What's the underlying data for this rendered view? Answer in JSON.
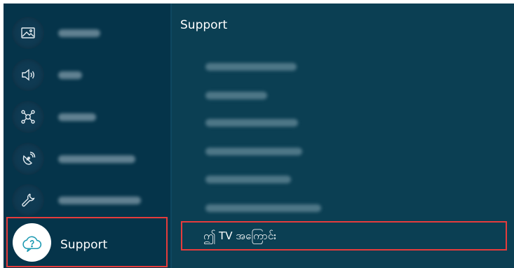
{
  "sidebar": {
    "items": [
      {
        "icon": "picture-icon",
        "label_hidden": true
      },
      {
        "icon": "sound-icon",
        "label_hidden": true
      },
      {
        "icon": "connection-icon",
        "label_hidden": true
      },
      {
        "icon": "broadcasting-icon",
        "label_hidden": true
      },
      {
        "icon": "wrench-icon",
        "label_hidden": true
      }
    ],
    "support": {
      "label": "Support",
      "icon": "support-cloud-question-icon"
    }
  },
  "panel": {
    "title": "Support",
    "items_hidden": 6,
    "about": {
      "label": "ဤ TV အကြောင်း"
    }
  },
  "colors": {
    "left_bg": "#05344a",
    "right_bg": "#0b3f53",
    "highlight": "#e63c3c"
  }
}
